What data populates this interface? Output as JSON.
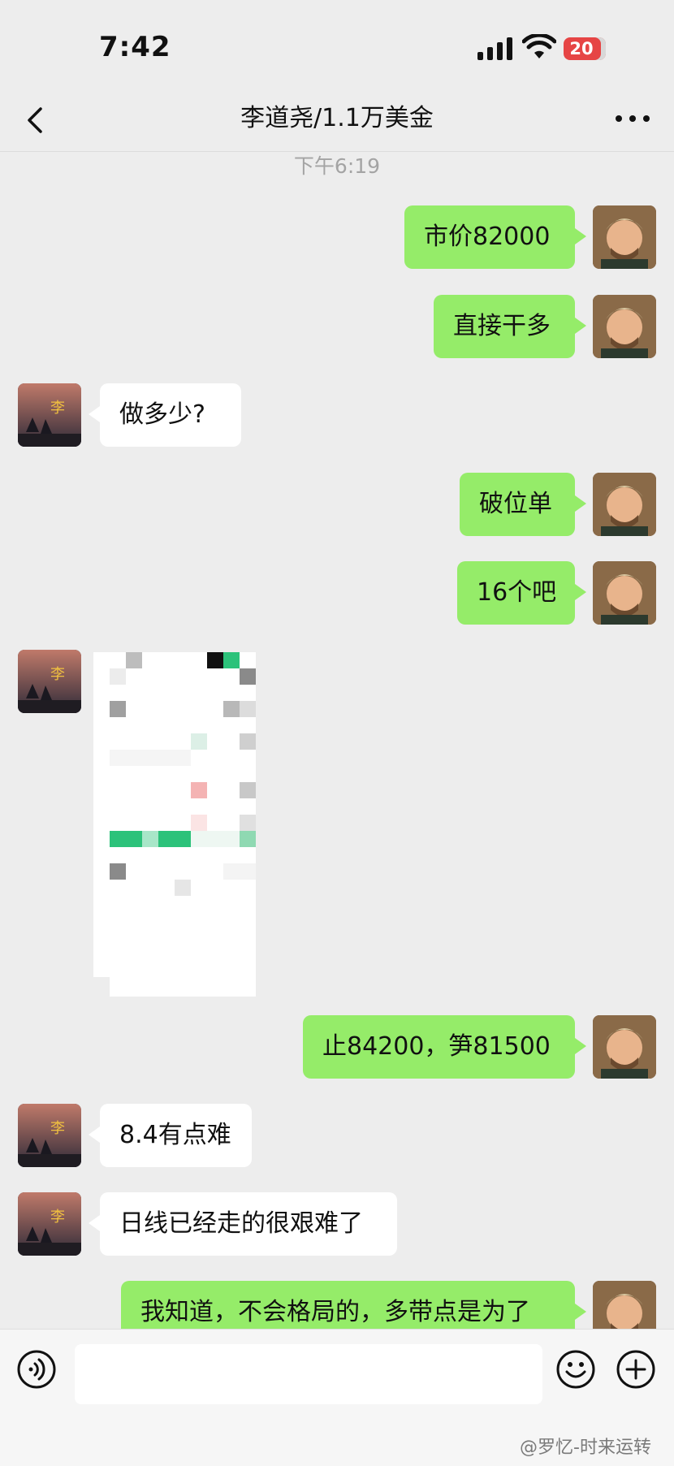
{
  "status_bar": {
    "time": "7:42",
    "battery": "20"
  },
  "nav": {
    "title": "李道尧/1.1万美金",
    "back_icon": "chevron-left-icon",
    "more_icon": "more-dots-icon"
  },
  "timestamp": "下午6:19",
  "messages": [
    {
      "from": "self",
      "text": "市价82000"
    },
    {
      "from": "self",
      "text": "直接干多"
    },
    {
      "from": "other",
      "text": "做多少?"
    },
    {
      "from": "self",
      "text": "破位单"
    },
    {
      "from": "self",
      "text": "16个吧"
    },
    {
      "from": "other",
      "type": "image"
    },
    {
      "from": "self",
      "text": "止84200，笋81500"
    },
    {
      "from": "other",
      "text": "8.4有点难"
    },
    {
      "from": "other",
      "text": "日线已经走的很艰难了"
    },
    {
      "from": "self",
      "text": "我知道，不会格局的，多带点是为了"
    }
  ],
  "input_bar": {
    "placeholder": "",
    "voice_icon": "voice-icon",
    "emoji_icon": "emoji-icon",
    "plus_icon": "plus-icon"
  },
  "watermark": "@罗忆-时来运转",
  "colors": {
    "background": "#ededed",
    "self_bubble": "#95ec69",
    "other_bubble": "#ffffff",
    "battery": "#e64545"
  }
}
